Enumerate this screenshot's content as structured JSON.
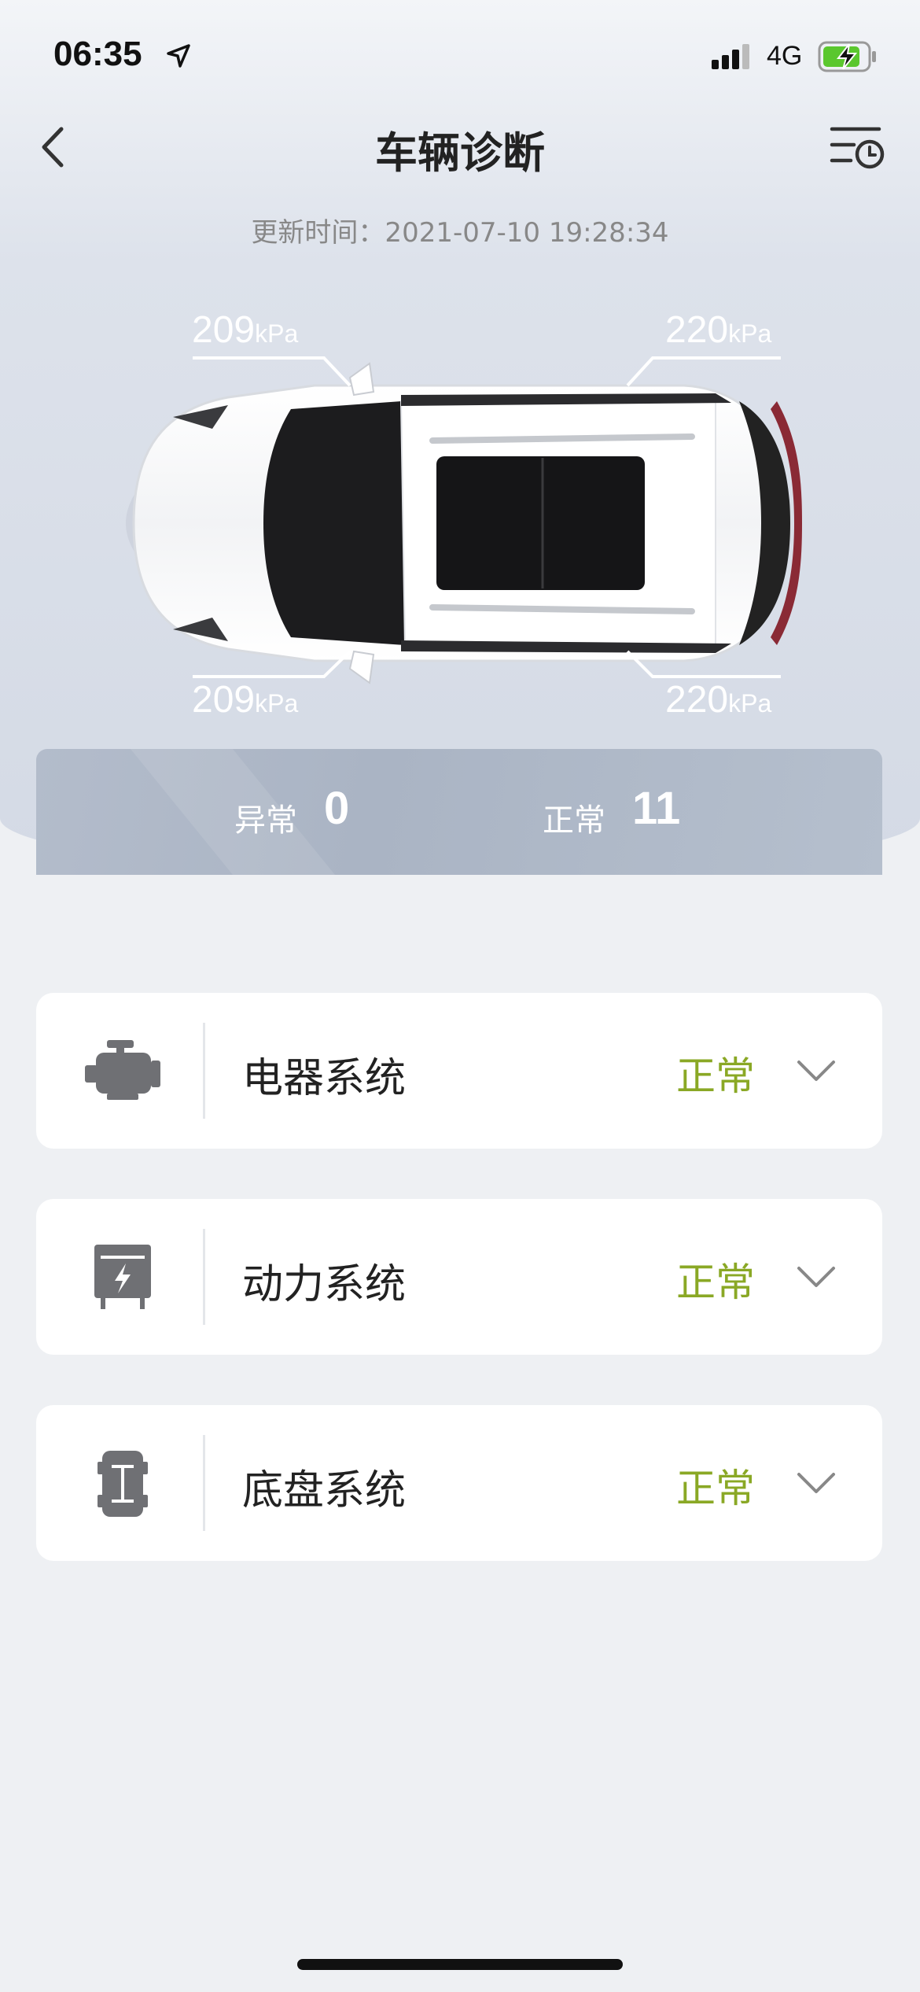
{
  "status_bar": {
    "time": "06:35",
    "network": "4G"
  },
  "header": {
    "title": "车辆诊断",
    "update_time": "更新时间：2021-07-10 19:28:34"
  },
  "tires": {
    "front_left": {
      "value": "209",
      "unit": "kPa"
    },
    "front_right": {
      "value": "220",
      "unit": "kPa"
    },
    "rear_left": {
      "value": "209",
      "unit": "kPa"
    },
    "rear_right": {
      "value": "220",
      "unit": "kPa"
    }
  },
  "summary": {
    "abnormal_label": "异常",
    "abnormal_count": "0",
    "normal_label": "正常",
    "normal_count": "11"
  },
  "systems": [
    {
      "name": "电器系统",
      "status": "正常",
      "icon": "engine-icon"
    },
    {
      "name": "动力系统",
      "status": "正常",
      "icon": "power-box-icon"
    },
    {
      "name": "底盘系统",
      "status": "正常",
      "icon": "chassis-icon"
    }
  ],
  "colors": {
    "status_normal": "#8aa825",
    "battery_green": "#5ac72e"
  }
}
